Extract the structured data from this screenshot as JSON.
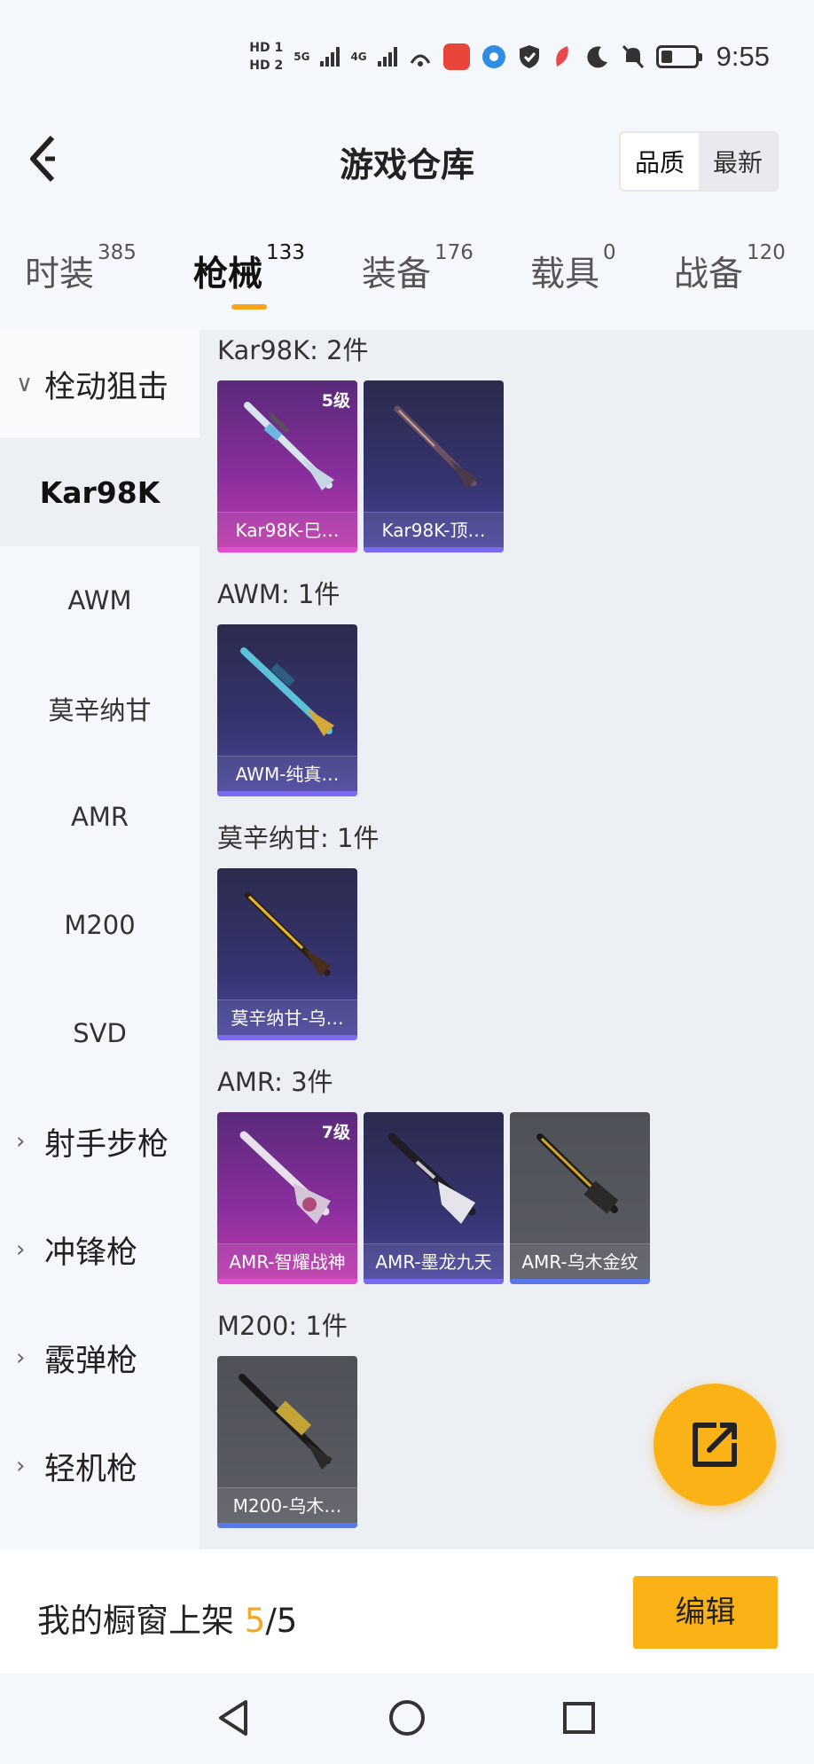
{
  "status_bar": {
    "hd1": "HD 1",
    "hd2": "HD 2",
    "net1": "5G",
    "net2": "4G",
    "time": "9:55"
  },
  "header": {
    "title": "游戏仓库",
    "sort_quality": "品质",
    "sort_newest": "最新"
  },
  "tabs": [
    {
      "label": "时装",
      "count": "385"
    },
    {
      "label": "枪械",
      "count": "133"
    },
    {
      "label": "装备",
      "count": "176"
    },
    {
      "label": "载具",
      "count": "0"
    },
    {
      "label": "战备",
      "count": "120"
    }
  ],
  "sidebar": {
    "items": [
      {
        "label": "栓动狙击",
        "type": "category",
        "expanded": true
      },
      {
        "label": "Kar98K",
        "type": "sub",
        "selected": true
      },
      {
        "label": "AWM",
        "type": "sub"
      },
      {
        "label": "莫辛纳甘",
        "type": "sub"
      },
      {
        "label": "AMR",
        "type": "sub"
      },
      {
        "label": "M200",
        "type": "sub"
      },
      {
        "label": "SVD",
        "type": "sub"
      },
      {
        "label": "射手步枪",
        "type": "category"
      },
      {
        "label": "冲锋枪",
        "type": "category"
      },
      {
        "label": "霰弹枪",
        "type": "category"
      },
      {
        "label": "轻机枪",
        "type": "category"
      }
    ]
  },
  "groups": [
    {
      "title": "Kar98K: 2件",
      "items": [
        {
          "name": "Kar98K-巳…",
          "level": "5级",
          "quality": "pink"
        },
        {
          "name": "Kar98K-顶…",
          "level": "",
          "quality": "purple"
        }
      ]
    },
    {
      "title": "AWM: 1件",
      "items": [
        {
          "name": "AWM-纯真…",
          "level": "",
          "quality": "purple"
        }
      ]
    },
    {
      "title": "莫辛纳甘: 1件",
      "items": [
        {
          "name": "莫辛纳甘-乌…",
          "level": "",
          "quality": "purple"
        }
      ]
    },
    {
      "title": "AMR: 3件",
      "items": [
        {
          "name": "AMR-智耀战神",
          "level": "7级",
          "quality": "pink"
        },
        {
          "name": "AMR-墨龙九天",
          "level": "",
          "quality": "purple"
        },
        {
          "name": "AMR-乌木金纹",
          "level": "",
          "quality": "gray"
        }
      ]
    },
    {
      "title": "M200: 1件",
      "items": [
        {
          "name": "M200-乌木…",
          "level": "",
          "quality": "gray"
        }
      ]
    }
  ],
  "footer": {
    "label": "我的橱窗上架",
    "current": "5",
    "separator": "/",
    "total": "5",
    "edit_label": "编辑"
  },
  "colors": {
    "accent": "#fbb217",
    "quality_pink_bar": "#e14fd0",
    "quality_purple_bar": "#7b6bf0",
    "quality_gray_bar": "#5a78e8"
  },
  "icons": {
    "back": "back-arrow-icon",
    "fab": "share-export-icon",
    "nav": [
      "nav-back-icon",
      "nav-home-icon",
      "nav-recents-icon"
    ]
  }
}
